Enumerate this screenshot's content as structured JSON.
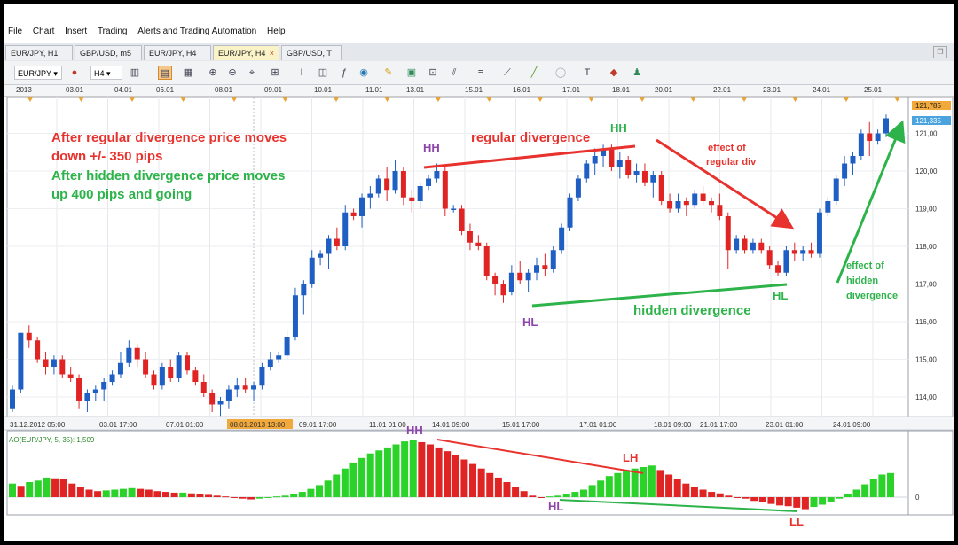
{
  "menu": [
    "File",
    "Chart",
    "Insert",
    "Trading",
    "Alerts and Trading Automation",
    "Help"
  ],
  "tabs": [
    {
      "label": "EUR/JPY, H1",
      "active": false
    },
    {
      "label": "GBP/USD, m5",
      "active": false
    },
    {
      "label": "EUR/JPY, H4",
      "active": false
    },
    {
      "label": "EUR/JPY, H4",
      "active": true,
      "close": "×"
    },
    {
      "label": "GBP/USD, T",
      "active": false
    }
  ],
  "toolbar": {
    "symbol": "EUR/JPY",
    "timeframe": "H4"
  },
  "top_dates": [
    "2013",
    "03.01",
    "04.01",
    "06.01",
    "08.01",
    "09.01",
    "10.01",
    "11.01",
    "13.01",
    "15.01",
    "16.01",
    "17.01",
    "18.01",
    "20.01",
    "22.01",
    "23.01",
    "24.01",
    "25.01"
  ],
  "chart_data": {
    "type": "candlestick",
    "symbol": "EUR/JPY",
    "timeframe": "H4",
    "price_ticks": [
      "121,00",
      "120,00",
      "119,00",
      "118,00",
      "117,00",
      "116,00",
      "115,00",
      "114,00"
    ],
    "price_labels": {
      "high": "121,785",
      "current": "121,335"
    },
    "time_labels": [
      "31.12.2012 05:00",
      "03.01 17:00",
      "07.01 01:00",
      "08.01.2013 13:00",
      "09.01 17:00",
      "11.01 01:00",
      "14.01 09:00",
      "15.01 17:00",
      "17.01 01:00",
      "18.01 09:00",
      "21.01 17:00",
      "23.01 01:00",
      "24.01 09:00"
    ],
    "candles": [
      [
        113.7,
        114.3,
        113.6,
        114.2
      ],
      [
        114.2,
        115.7,
        114.1,
        115.7
      ],
      [
        115.7,
        115.9,
        115.3,
        115.5
      ],
      [
        115.5,
        115.6,
        114.9,
        115.0
      ],
      [
        115.0,
        115.2,
        114.6,
        114.8
      ],
      [
        114.8,
        115.1,
        114.6,
        115.0
      ],
      [
        115.0,
        115.1,
        114.5,
        114.6
      ],
      [
        114.6,
        114.8,
        114.4,
        114.5
      ],
      [
        114.5,
        114.6,
        113.7,
        113.9
      ],
      [
        113.9,
        114.2,
        113.6,
        114.1
      ],
      [
        114.1,
        114.3,
        113.9,
        114.2
      ],
      [
        114.2,
        114.5,
        113.9,
        114.4
      ],
      [
        114.4,
        114.7,
        114.3,
        114.6
      ],
      [
        114.6,
        115.2,
        114.5,
        114.9
      ],
      [
        114.9,
        115.5,
        114.8,
        115.3
      ],
      [
        115.3,
        115.4,
        114.8,
        115.0
      ],
      [
        115.0,
        115.2,
        114.5,
        114.6
      ],
      [
        114.6,
        114.7,
        114.2,
        114.3
      ],
      [
        114.3,
        114.9,
        114.2,
        114.8
      ],
      [
        114.8,
        115.0,
        114.4,
        114.5
      ],
      [
        114.5,
        115.2,
        114.4,
        115.1
      ],
      [
        115.1,
        115.2,
        114.6,
        114.7
      ],
      [
        114.7,
        114.8,
        114.3,
        114.4
      ],
      [
        114.4,
        114.6,
        114.0,
        114.1
      ],
      [
        114.1,
        114.2,
        113.6,
        113.8
      ],
      [
        113.8,
        114.0,
        113.5,
        113.9
      ],
      [
        113.9,
        114.3,
        113.7,
        114.2
      ],
      [
        114.2,
        114.5,
        114.0,
        114.3
      ],
      [
        114.3,
        114.5,
        114.1,
        114.2
      ],
      [
        114.2,
        114.4,
        113.9,
        114.3
      ],
      [
        114.3,
        114.9,
        114.2,
        114.8
      ],
      [
        114.8,
        115.2,
        114.7,
        115.0
      ],
      [
        115.0,
        115.2,
        114.9,
        115.1
      ],
      [
        115.1,
        115.8,
        115.0,
        115.6
      ],
      [
        115.6,
        116.9,
        115.5,
        116.7
      ],
      [
        116.7,
        117.1,
        116.2,
        117.0
      ],
      [
        117.0,
        117.9,
        116.9,
        117.7
      ],
      [
        117.7,
        117.9,
        117.5,
        117.8
      ],
      [
        117.8,
        118.3,
        117.4,
        118.2
      ],
      [
        118.2,
        118.5,
        117.9,
        118.0
      ],
      [
        118.0,
        119.1,
        117.9,
        118.9
      ],
      [
        118.9,
        119.0,
        118.7,
        118.8
      ],
      [
        118.8,
        119.4,
        118.5,
        119.3
      ],
      [
        119.3,
        119.6,
        119.0,
        119.4
      ],
      [
        119.4,
        119.9,
        119.3,
        119.8
      ],
      [
        119.8,
        120.1,
        119.2,
        119.5
      ],
      [
        119.5,
        120.3,
        119.4,
        120.0
      ],
      [
        120.0,
        120.1,
        119.1,
        119.3
      ],
      [
        119.3,
        119.5,
        118.9,
        119.2
      ],
      [
        119.2,
        119.7,
        119.0,
        119.6
      ],
      [
        119.6,
        119.9,
        119.5,
        119.8
      ],
      [
        119.8,
        120.2,
        119.7,
        120.0
      ],
      [
        120.0,
        120.1,
        118.8,
        119.0
      ],
      [
        119.0,
        119.1,
        118.9,
        119.0
      ],
      [
        119.0,
        119.1,
        118.3,
        118.4
      ],
      [
        118.4,
        118.6,
        117.9,
        118.1
      ],
      [
        118.1,
        118.3,
        117.9,
        118.0
      ],
      [
        118.0,
        118.1,
        117.1,
        117.2
      ],
      [
        117.2,
        117.3,
        116.7,
        117.0
      ],
      [
        117.0,
        117.1,
        116.5,
        116.7
      ],
      [
        116.8,
        117.5,
        116.7,
        117.3
      ],
      [
        117.3,
        117.6,
        117.0,
        117.1
      ],
      [
        117.1,
        117.4,
        116.8,
        117.3
      ],
      [
        117.3,
        117.7,
        117.1,
        117.5
      ],
      [
        117.5,
        117.8,
        117.2,
        117.4
      ],
      [
        117.4,
        118.0,
        117.3,
        117.9
      ],
      [
        117.9,
        118.6,
        117.8,
        118.5
      ],
      [
        118.5,
        119.4,
        118.4,
        119.3
      ],
      [
        119.3,
        119.9,
        119.2,
        119.8
      ],
      [
        119.8,
        120.3,
        119.7,
        120.2
      ],
      [
        120.2,
        120.6,
        119.9,
        120.4
      ],
      [
        120.4,
        120.7,
        120.1,
        120.6
      ],
      [
        120.6,
        120.7,
        120.0,
        120.1
      ],
      [
        120.1,
        120.5,
        119.8,
        120.3
      ],
      [
        120.3,
        120.4,
        119.8,
        119.9
      ],
      [
        119.9,
        120.2,
        119.7,
        120.0
      ],
      [
        120.0,
        120.2,
        119.6,
        119.7
      ],
      [
        119.7,
        120.0,
        119.3,
        119.9
      ],
      [
        119.9,
        120.0,
        119.1,
        119.2
      ],
      [
        119.2,
        119.4,
        118.9,
        119.0
      ],
      [
        119.0,
        119.4,
        118.9,
        119.2
      ],
      [
        119.2,
        119.3,
        118.8,
        119.1
      ],
      [
        119.1,
        119.5,
        119.0,
        119.4
      ],
      [
        119.4,
        119.6,
        119.1,
        119.2
      ],
      [
        119.2,
        119.3,
        118.9,
        119.1
      ],
      [
        119.1,
        119.4,
        118.7,
        118.8
      ],
      [
        118.8,
        118.9,
        117.4,
        117.9
      ],
      [
        117.9,
        118.3,
        117.8,
        118.2
      ],
      [
        118.2,
        118.3,
        117.8,
        117.9
      ],
      [
        117.9,
        118.2,
        117.8,
        118.1
      ],
      [
        118.1,
        118.2,
        117.8,
        117.9
      ],
      [
        117.9,
        118.0,
        117.4,
        117.5
      ],
      [
        117.5,
        117.6,
        117.2,
        117.3
      ],
      [
        117.3,
        118.0,
        117.2,
        117.9
      ],
      [
        117.9,
        118.1,
        117.6,
        117.8
      ],
      [
        117.8,
        118.0,
        117.6,
        117.9
      ],
      [
        117.9,
        118.1,
        117.7,
        117.8
      ],
      [
        117.8,
        119.0,
        117.7,
        118.9
      ],
      [
        118.9,
        119.3,
        118.8,
        119.2
      ],
      [
        119.2,
        119.9,
        119.1,
        119.8
      ],
      [
        119.8,
        120.4,
        119.6,
        120.2
      ],
      [
        120.2,
        120.5,
        119.9,
        120.4
      ],
      [
        120.4,
        121.1,
        120.3,
        121.0
      ],
      [
        121.0,
        121.3,
        120.4,
        120.8
      ],
      [
        120.8,
        121.1,
        120.7,
        121.0
      ],
      [
        121.0,
        121.5,
        120.9,
        121.4
      ]
    ],
    "annotations": {
      "text1": "After regular divergence price moves",
      "text2": "down +/- 350 pips",
      "text3": "After hidden divergence price moves",
      "text4": "up 400 pips and going",
      "regular": "regular divergence",
      "hidden": "hidden divergence",
      "effect_reg1": "effect of",
      "effect_reg2": "regular div",
      "effect_hid1": "effect of",
      "effect_hid2": "hidden",
      "effect_hid3": "divergence",
      "hh1": "HH",
      "hh2": "HH",
      "hl1": "HL",
      "hl2": "HL"
    },
    "indicator": {
      "label": "AO(EUR/JPY, 5, 35): 1,509",
      "zero_label": "0",
      "annotations": {
        "hh": "HH",
        "lh": "LH",
        "hl": "HL",
        "ll": "LL"
      },
      "values": [
        0.9,
        0.75,
        1.0,
        1.1,
        1.3,
        1.25,
        1.2,
        0.9,
        0.7,
        0.5,
        0.4,
        0.45,
        0.5,
        0.55,
        0.6,
        0.55,
        0.5,
        0.4,
        0.35,
        0.3,
        0.3,
        0.25,
        0.2,
        0.15,
        0.1,
        0.05,
        -0.05,
        -0.1,
        -0.15,
        -0.1,
        -0.05,
        0.05,
        0.1,
        0.2,
        0.35,
        0.55,
        0.8,
        1.1,
        1.5,
        1.9,
        2.3,
        2.6,
        2.9,
        3.1,
        3.3,
        3.5,
        3.7,
        3.8,
        3.65,
        3.5,
        3.3,
        3.05,
        2.8,
        2.5,
        2.2,
        1.9,
        1.6,
        1.3,
        1.0,
        0.7,
        0.4,
        0.1,
        -0.05,
        0.05,
        0.1,
        0.2,
        0.35,
        0.5,
        0.8,
        1.1,
        1.4,
        1.6,
        1.8,
        1.9,
        2.0,
        2.1,
        1.8,
        1.5,
        1.2,
        0.9,
        0.7,
        0.5,
        0.35,
        0.25,
        0.1,
        0.0,
        -0.1,
        -0.25,
        -0.35,
        -0.45,
        -0.55,
        -0.6,
        -0.7,
        -0.8,
        -0.65,
        -0.5,
        -0.3,
        -0.1,
        0.2,
        0.5,
        0.85,
        1.2,
        1.5,
        1.6
      ]
    }
  }
}
